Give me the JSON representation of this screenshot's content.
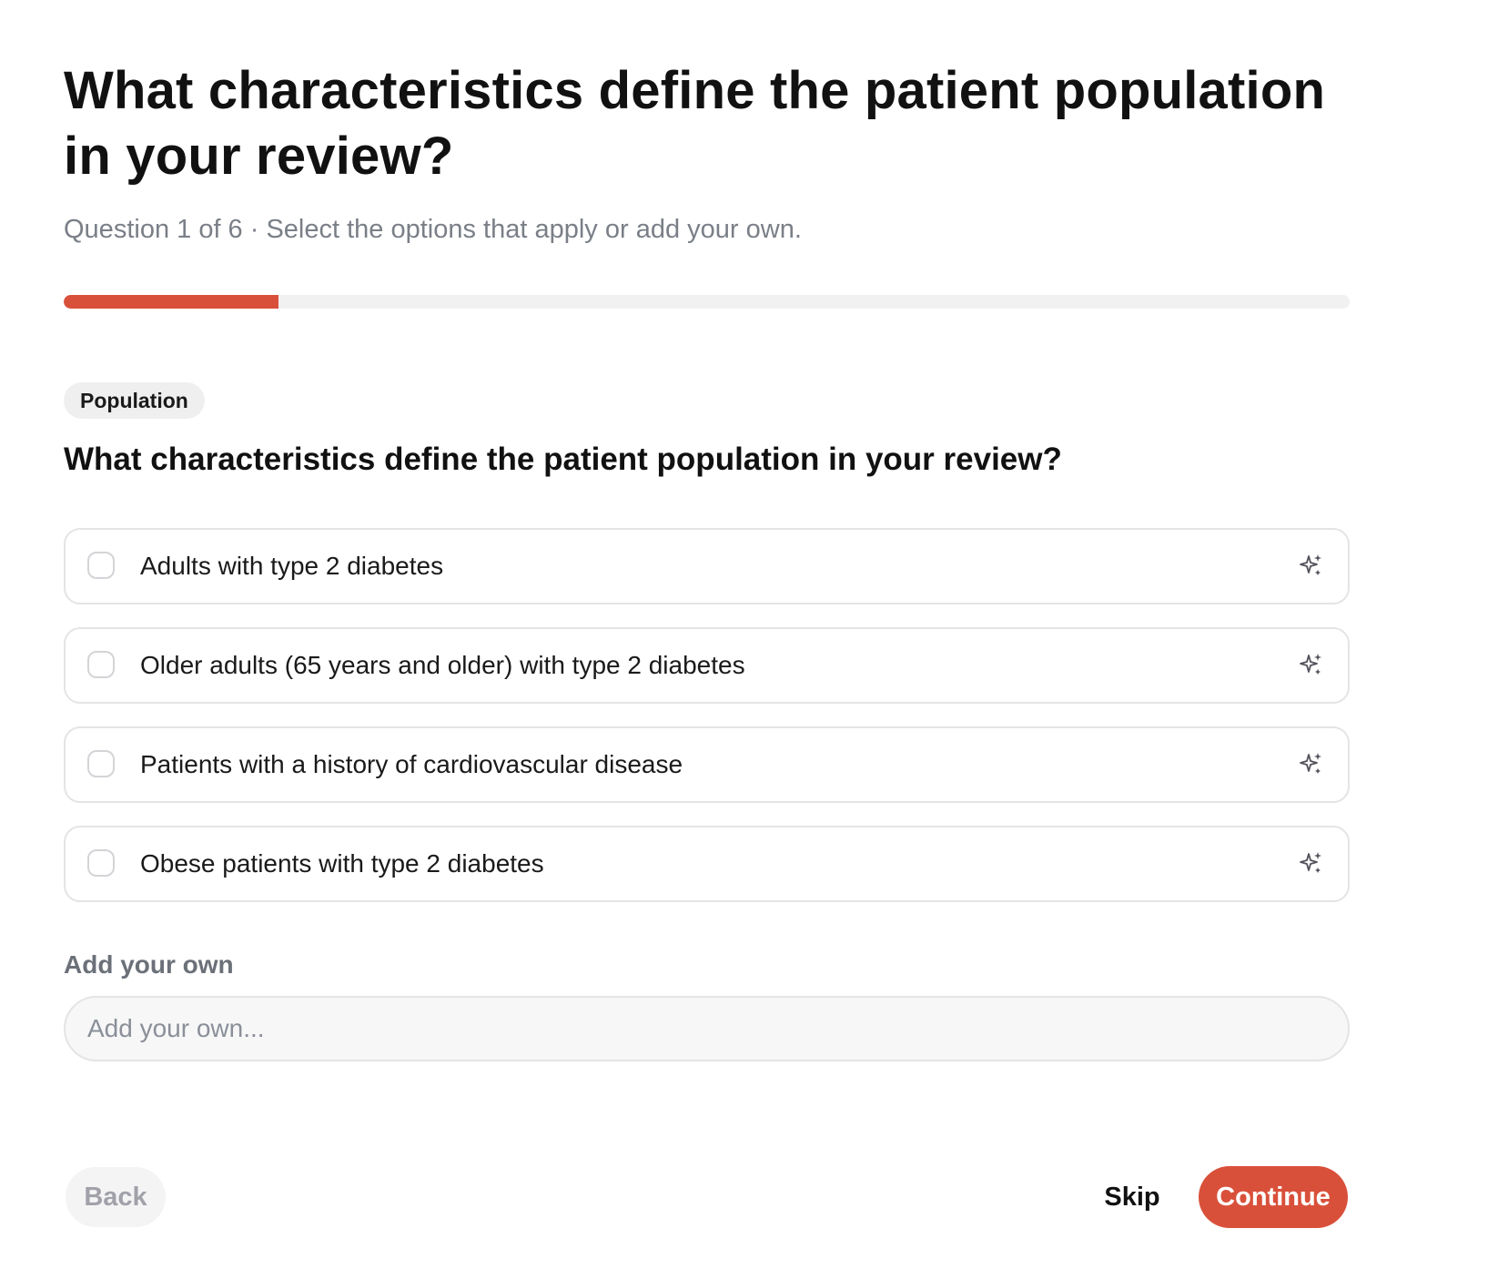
{
  "header": {
    "title": "What characteristics define the patient population in your review?",
    "subtitle": "Question 1 of 6 · Select the options that apply or add your own."
  },
  "progress": {
    "current": 1,
    "total": 6,
    "fraction": 0.1667,
    "fill_color": "#d9503a",
    "track_color": "#f1f1f1"
  },
  "section": {
    "tag": "Population",
    "question": "What characteristics define the patient population in your review?"
  },
  "options": [
    {
      "label": "Adults with type 2 diabetes",
      "icon": "sparkle-icon",
      "checked": false
    },
    {
      "label": "Older adults (65 years and older) with type 2 diabetes",
      "icon": "sparkle-icon",
      "checked": false
    },
    {
      "label": "Patients with a history of cardiovascular disease",
      "icon": "sparkle-icon",
      "checked": false
    },
    {
      "label": "Obese patients with type 2 diabetes",
      "icon": "sparkle-icon",
      "checked": false
    }
  ],
  "custom": {
    "label": "Add your own",
    "placeholder": "Add your own...",
    "value": ""
  },
  "footer": {
    "back_label": "Back",
    "skip_label": "Skip",
    "continue_label": "Continue"
  },
  "colors": {
    "accent": "#d9503a",
    "text": "#111111",
    "muted": "#7a7f87"
  }
}
